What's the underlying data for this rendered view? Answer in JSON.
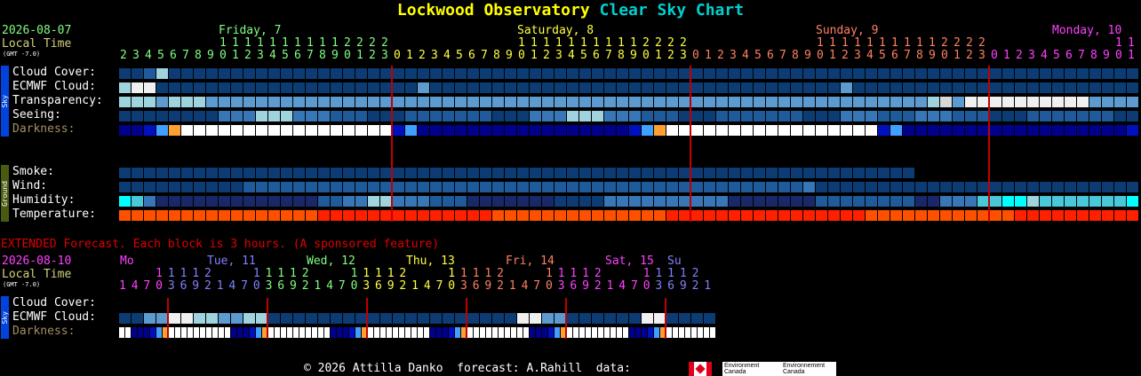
{
  "title": {
    "part1": "Lockwood Observatory",
    "part2": "Clear Sky Chart"
  },
  "header": {
    "date": "2026-08-07",
    "local_time": "Local Time",
    "gmt": "(GMT -7.0)",
    "days": [
      {
        "label": "Friday, 7",
        "color": "#80ff80"
      },
      {
        "label": "Saturday, 8",
        "color": "#ffff40"
      },
      {
        "label": "Sunday, 9",
        "color": "#ff8060"
      },
      {
        "label": "Monday, 10",
        "color": "#ff40ff"
      }
    ]
  },
  "sidebars": {
    "sky": "Sky",
    "ground": "Ground"
  },
  "rows": {
    "cloud": "Cloud Cover:",
    "ecmwf": "ECMWF Cloud:",
    "transparency": "Transparency:",
    "seeing": "Seeing:",
    "darkness": "Darkness:",
    "smoke": "Smoke:",
    "wind": "Wind:",
    "humidity": "Humidity:",
    "temperature": "Temperature:"
  },
  "extended": {
    "note": "EXTENDED Forecast. Each block is 3 hours. (A sponsored feature)",
    "date": "2026-08-10",
    "local_time": "Local Time",
    "gmt": "(GMT -7.0)",
    "days": [
      {
        "label": "Mo",
        "color": "#ff40ff"
      },
      {
        "label": "Tue, 11",
        "color": "#8080ff"
      },
      {
        "label": "Wed, 12",
        "color": "#80ff80"
      },
      {
        "label": "Thu, 13",
        "color": "#ffff40"
      },
      {
        "label": "Fri, 14",
        "color": "#ff8060"
      },
      {
        "label": "Sat, 15",
        "color": "#ff40ff"
      },
      {
        "label": "Su",
        "color": "#8080ff"
      }
    ],
    "hours": [
      1,
      4,
      7,
      10,
      13,
      16,
      19,
      22,
      1,
      4,
      7,
      10,
      13,
      16,
      19,
      22,
      1,
      4,
      7,
      10,
      13,
      16,
      19,
      22,
      1,
      4,
      7,
      10,
      13,
      16,
      19,
      22,
      1,
      4,
      7,
      10,
      13,
      16,
      19,
      22,
      1,
      4,
      7,
      10,
      13,
      16,
      19,
      22,
      1
    ],
    "rows": {
      "cloud": "Cloud Cover:",
      "ecmwf": "ECMWF Cloud:",
      "darkness": "Darkness:"
    }
  },
  "hours": [
    2,
    3,
    4,
    5,
    6,
    7,
    8,
    9,
    10,
    11,
    12,
    13,
    14,
    15,
    16,
    17,
    18,
    19,
    20,
    21,
    22,
    23,
    0,
    1,
    2,
    3,
    4,
    5,
    6,
    7,
    8,
    9,
    10,
    11,
    12,
    13,
    14,
    15,
    16,
    17,
    18,
    19,
    20,
    21,
    22,
    23,
    0,
    1,
    2,
    3,
    4,
    5,
    6,
    7,
    8,
    9,
    10,
    11,
    12,
    13,
    14,
    15,
    16,
    17,
    18,
    19,
    20,
    21,
    22,
    23,
    0,
    1,
    2,
    3,
    4,
    5,
    6,
    7,
    8,
    9,
    10,
    11
  ],
  "footer": {
    "copyright": "© 2026 Attilla Danko  forecast: A.Rahill  data:",
    "ec1": "Environment Canada",
    "ec2": "Environnement Canada"
  },
  "palette": {
    "N": "#0d3b73",
    "D": "#1f5a9a",
    "B": "#3777b8",
    "L": "#5c9ad0",
    "C": "#9fd3dd",
    "W": "#f0f0f0",
    "G": "#d8d8d8",
    "T": "#2a6da8",
    "K": "#00008a",
    "b": "#0010c0",
    "l": "#1060ff",
    "a": "#40a0ff",
    "s": "#ffa030",
    "y": "#f8e8b0",
    "w": "#ffffff",
    "c": "#00ffff",
    "h": "#48c8d8",
    "o": "#ff5000",
    "r": "#ff2000",
    "R": "#e00000",
    "M": "#b00000",
    "n": "#182868"
  }
}
